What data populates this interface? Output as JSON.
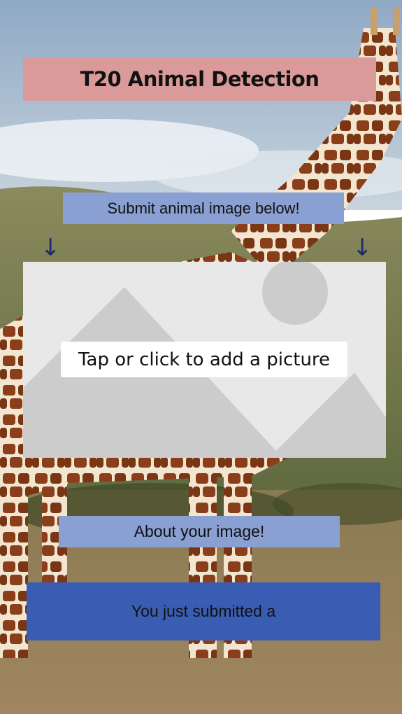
{
  "header": {
    "title": "T20 Animal Detection"
  },
  "upload": {
    "instruction": "Submit animal image below!",
    "arrow_left": "↓",
    "arrow_right": "↓",
    "cta": "Tap or click to add a picture"
  },
  "result": {
    "about_label": "About your image!",
    "text": "You just submitted a"
  },
  "background": {
    "subject": "giraffe-in-savanna-photo"
  }
}
